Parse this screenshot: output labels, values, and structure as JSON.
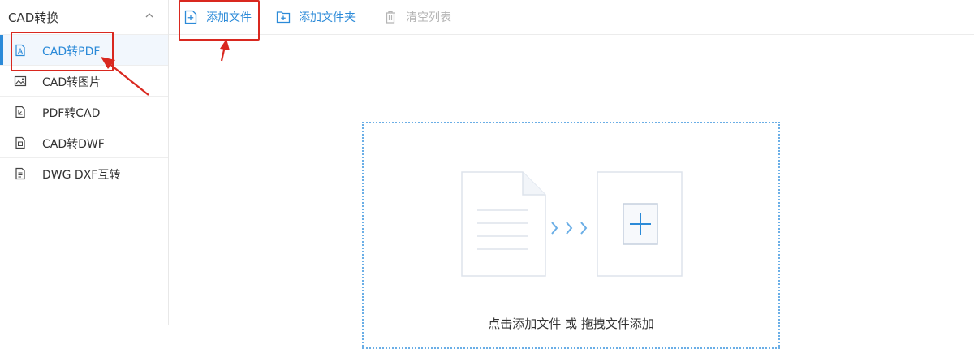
{
  "sidebar": {
    "header": {
      "title": "CAD转换",
      "icon": "chevron-up-icon"
    },
    "items": [
      {
        "label": "CAD转PDF",
        "icon": "pdf-file-icon",
        "active": true
      },
      {
        "label": "CAD转图片",
        "icon": "image-icon",
        "active": false
      },
      {
        "label": "PDF转CAD",
        "icon": "cad-file-icon",
        "active": false
      },
      {
        "label": "CAD转DWF",
        "icon": "dwf-file-icon",
        "active": false
      },
      {
        "label": "DWG DXF互转",
        "icon": "convert-file-icon",
        "active": false
      }
    ]
  },
  "toolbar": {
    "add_file": "添加文件",
    "add_folder": "添加文件夹",
    "clear_list": "清空列表"
  },
  "drop_zone": {
    "hint": "点击添加文件 或 拖拽文件添加"
  },
  "colors": {
    "accent": "#2b8ad8",
    "annotation": "#d9281f",
    "disabled": "#b5b5b5"
  }
}
